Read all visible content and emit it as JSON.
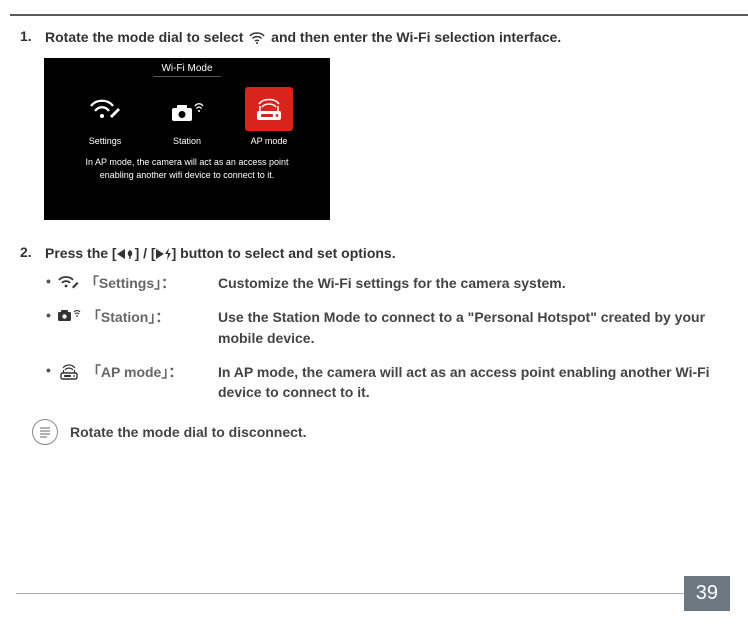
{
  "step1": {
    "num": "1.",
    "text_before": "Rotate the mode dial to select ",
    "text_after": " and then enter the Wi-Fi selection interface."
  },
  "mockup": {
    "title": "Wi-Fi Mode",
    "items": [
      {
        "label": "Settings"
      },
      {
        "label": "Station"
      },
      {
        "label": "AP mode"
      }
    ],
    "desc_line1": "In AP mode, the camera will act as an access point",
    "desc_line2": "enabling another wifi device to connect to it."
  },
  "step2": {
    "num": "2.",
    "text": "Press the [◀▮] / [▶⯐] button to select and set options."
  },
  "options": [
    {
      "label": "「Settings」：",
      "desc": "Customize the Wi-Fi settings for the camera system."
    },
    {
      "label": "「Station」：",
      "desc": "Use the Station Mode to connect to a \"Personal Hotspot\" created by your mobile device."
    },
    {
      "label": "「AP mode」：",
      "desc": "In AP mode, the camera will act as an access point enabling another Wi-Fi device to connect to it."
    }
  ],
  "note": "Rotate the mode dial to disconnect.",
  "page_number": "39"
}
